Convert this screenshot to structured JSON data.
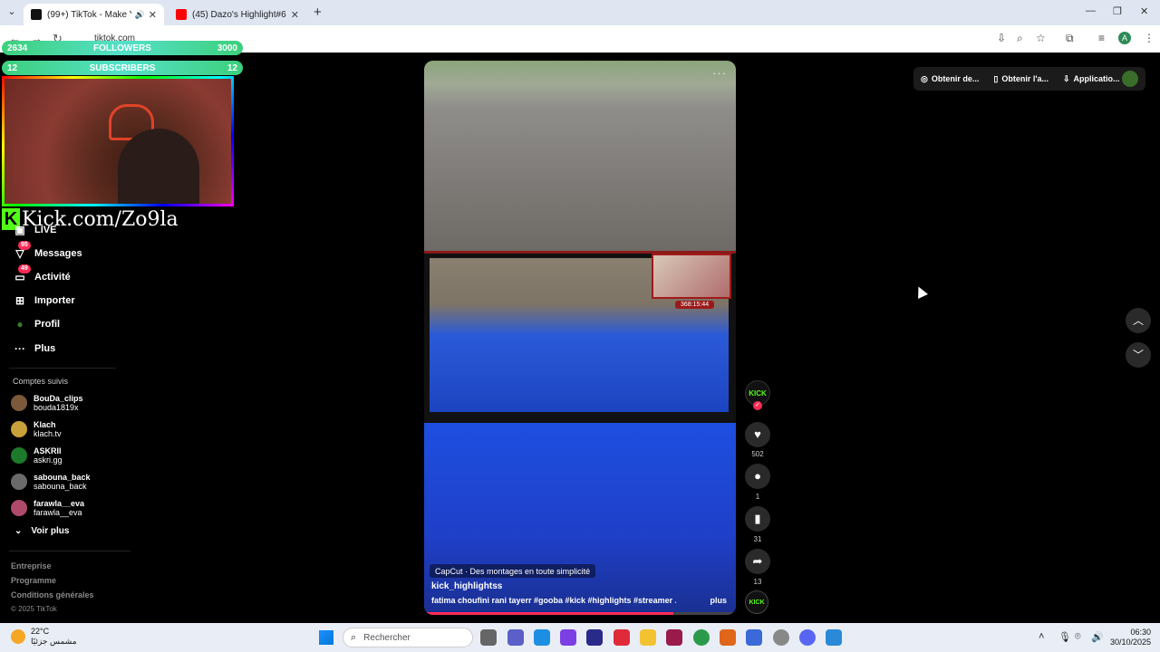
{
  "browser": {
    "tabs": [
      {
        "title": "(99+) TikTok - Make Your Day",
        "active": true
      },
      {
        "title": "(45) Dazo's Highlight#6 | Vagos",
        "active": false
      }
    ],
    "url": "tiktok.com"
  },
  "overlay": {
    "followers": {
      "left": "2634",
      "label": "FOLLOWERS",
      "right": "3000"
    },
    "subscribers": {
      "left": "12",
      "label": "SUBSCRIBERS",
      "right": "12"
    },
    "kick_url": "Kick.com/Zo9la",
    "kick_letter": "K"
  },
  "sidebar": {
    "nav": [
      {
        "label": "LIVE",
        "icon": "live-icon",
        "badge": ""
      },
      {
        "label": "Messages",
        "icon": "messages-icon",
        "badge": "95"
      },
      {
        "label": "Activité",
        "icon": "activity-icon",
        "badge": "49"
      },
      {
        "label": "Importer",
        "icon": "upload-icon",
        "badge": ""
      },
      {
        "label": "Profil",
        "icon": "profile-icon",
        "badge": ""
      },
      {
        "label": "Plus",
        "icon": "more-icon",
        "badge": ""
      }
    ],
    "following_title": "Comptes suivis",
    "following": [
      {
        "name": "BouDa_clips",
        "handle": "bouda1819x",
        "color": "#7a5a3a"
      },
      {
        "name": "Klach",
        "handle": "klach.tv",
        "color": "#c9a13a"
      },
      {
        "name": "ASKRII",
        "handle": "askri.gg",
        "color": "#1c7a2a"
      },
      {
        "name": "sabouna_back",
        "handle": "sabouna_back",
        "color": "#6a6a6a"
      },
      {
        "name": "farawla__eva",
        "handle": "farawla__eva",
        "color": "#b04a6a"
      }
    ],
    "see_more": "Voir plus",
    "footer": [
      "Entreprise",
      "Programme",
      "Conditions générales"
    ],
    "copyright": "© 2025 TikTok"
  },
  "video": {
    "stream_timer": "368:15:44",
    "capcut": "CapCut · Des montages en toute simplicité",
    "author": "kick_highlightss",
    "description": "fatima choufini rani tayerr #gooba #kick #highlights #streamer ...",
    "more": "plus",
    "progress": 0.8
  },
  "actions": {
    "creator_label": "KICK",
    "likes": "502",
    "comments": "1",
    "saves": "31",
    "shares": "13",
    "music_label": "KICK"
  },
  "topright": {
    "btn1": "Obtenir de...",
    "btn2": "Obtenir l'a...",
    "btn3": "Applicatio..."
  },
  "taskbar": {
    "temp": "22°C",
    "weather": "مشمس جزئيًا",
    "search": "Rechercher",
    "time": "06:30",
    "date": "30/10/2025"
  }
}
